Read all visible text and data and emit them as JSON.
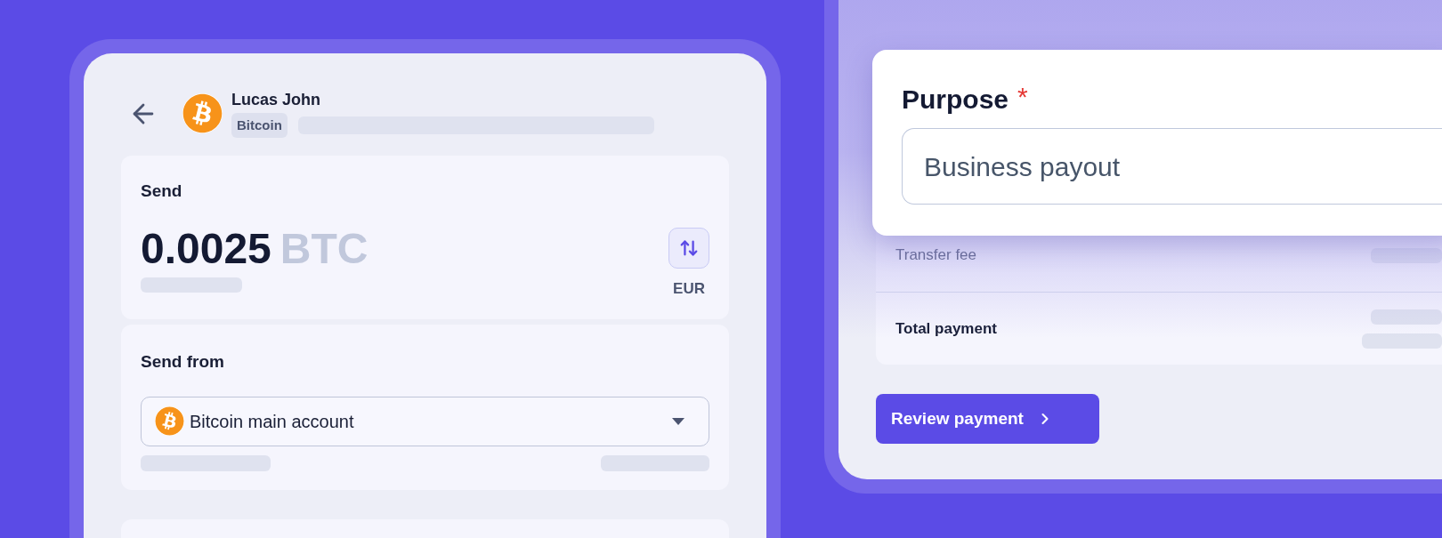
{
  "recipient": {
    "name": "Lucas John",
    "badge": "Bitcoin"
  },
  "send": {
    "label": "Send",
    "amount": "0.0025",
    "unit": "BTC",
    "toggle_currency": "EUR"
  },
  "send_from": {
    "label": "Send from",
    "account": "Bitcoin main account"
  },
  "purpose": {
    "label": "Purpose",
    "required_mark": "*",
    "value": "Business payout"
  },
  "summary": {
    "rows": [
      {
        "label": "Transfer fee",
        "kind": "muted"
      },
      {
        "label": "Total payment",
        "kind": "strong"
      }
    ]
  },
  "review_button": {
    "label": "Review payment"
  }
}
